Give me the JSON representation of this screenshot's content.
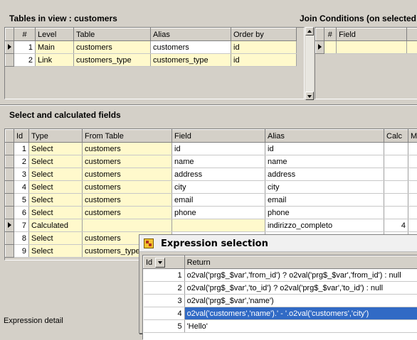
{
  "tables_section": {
    "title": "Tables in view : customers",
    "columns": [
      "#",
      "Level",
      "Table",
      "Alias",
      "Order by"
    ],
    "rows": [
      {
        "num": "1",
        "level": "Main",
        "table": "customers",
        "alias": "customers",
        "order_by": "id"
      },
      {
        "num": "2",
        "level": "Link",
        "table": "customers_type",
        "alias": "customers_type",
        "order_by": "id"
      }
    ]
  },
  "join_section": {
    "title": "Join Conditions (on selected",
    "columns": [
      "#",
      "Field"
    ]
  },
  "fields_section": {
    "title": "Select and calculated fields",
    "columns": [
      "Id",
      "Type",
      "From Table",
      "Field",
      "Alias",
      "Calc",
      "M"
    ],
    "rows": [
      {
        "id": "1",
        "type": "Select",
        "from_table": "customers",
        "field": "id",
        "alias": "id",
        "calc": ""
      },
      {
        "id": "2",
        "type": "Select",
        "from_table": "customers",
        "field": "name",
        "alias": "name",
        "calc": ""
      },
      {
        "id": "3",
        "type": "Select",
        "from_table": "customers",
        "field": "address",
        "alias": "address",
        "calc": ""
      },
      {
        "id": "4",
        "type": "Select",
        "from_table": "customers",
        "field": "city",
        "alias": "city",
        "calc": ""
      },
      {
        "id": "5",
        "type": "Select",
        "from_table": "customers",
        "field": "email",
        "alias": "email",
        "calc": ""
      },
      {
        "id": "6",
        "type": "Select",
        "from_table": "customers",
        "field": "phone",
        "alias": "phone",
        "calc": ""
      },
      {
        "id": "7",
        "type": "Calculated",
        "from_table": "",
        "field": "",
        "alias": "indirizzo_completo",
        "calc": "4"
      },
      {
        "id": "8",
        "type": "Select",
        "from_table": "customers",
        "field": "",
        "alias": "",
        "calc": ""
      },
      {
        "id": "9",
        "type": "Select",
        "from_table": "customers_type",
        "field": "",
        "alias": "",
        "calc": ""
      }
    ]
  },
  "expression_detail_label": "Expression detail",
  "dialog": {
    "title": "Expression selection",
    "columns": [
      "Id",
      "Return"
    ],
    "rows": [
      {
        "id": "1",
        "return": "o2val('prg$_$var','from_id') ? o2val('prg$_$var','from_id') : null"
      },
      {
        "id": "2",
        "return": "o2val('prg$_$var','to_id') ? o2val('prg$_$var','to_id') : null"
      },
      {
        "id": "3",
        "return": "o2val('prg$_$var','name')"
      },
      {
        "id": "4",
        "return": "o2val('customers','name').' - '.o2val('customers','city')"
      },
      {
        "id": "5",
        "return": "'Hello'"
      }
    ],
    "selected_id": "4"
  },
  "colors": {
    "window_bg": "#d4d0c8",
    "cell_yellow": "#fff9cc",
    "selection_blue": "#316ac5"
  }
}
